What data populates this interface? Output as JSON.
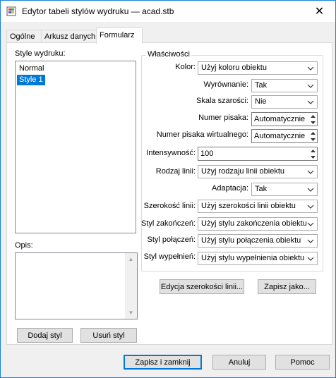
{
  "window": {
    "title": "Edytor tabeli stylów wydruku — acad.stb",
    "close_glyph": "✕"
  },
  "tabs": [
    {
      "label": "Ogólne"
    },
    {
      "label": "Arkusz danych"
    },
    {
      "label": "Formularz"
    }
  ],
  "styles": {
    "label": "Style wydruku:",
    "items": [
      {
        "label": "Normal"
      },
      {
        "label": "Style 1"
      }
    ],
    "selected": "Style 1"
  },
  "description": {
    "label": "Opis:",
    "value": ""
  },
  "buttons": {
    "add_style": "Dodaj styl",
    "remove_style": "Usuń styl",
    "edit_widths": "Edycja szerokości linii...",
    "save_as": "Zapisz jako...",
    "save_close": "Zapisz i zamknij",
    "cancel": "Anuluj",
    "help": "Pomoc"
  },
  "properties": {
    "title": "Właściwości",
    "color": {
      "label": "Kolor:",
      "value": "Użyj koloru obiektu"
    },
    "dither": {
      "label": "Wyrównanie:",
      "value": "Tak"
    },
    "grayscale": {
      "label": "Skala szarości:",
      "value": "Nie"
    },
    "pen_number": {
      "label": "Numer pisaka:",
      "value": "Automatycznie"
    },
    "virtual_pen": {
      "label": "Numer pisaka wirtualnego:",
      "value": "Automatycznie"
    },
    "screening": {
      "label": "Intensywność:",
      "value": "100"
    },
    "linetype": {
      "label": "Rodzaj linii:",
      "value": "Użyj rodzaju linii obiektu"
    },
    "adaptive": {
      "label": "Adaptacja:",
      "value": "Tak"
    },
    "lineweight": {
      "label": "Szerokość linii:",
      "value": "Użyj szerokości linii obiektu"
    },
    "line_end": {
      "label": "Styl zakończeń:",
      "value": "Użyj stylu zakończenia obiektu"
    },
    "line_join": {
      "label": "Styl połączeń:",
      "value": "Użyj stylu połączenia obiektu"
    },
    "fill": {
      "label": "Styl wypełnień:",
      "value": "Użyj stylu wypełnienia obiektu"
    }
  },
  "colors": {
    "accent": "#0078d7",
    "selected_bg": "#0078d7",
    "border": "#1883d7"
  }
}
